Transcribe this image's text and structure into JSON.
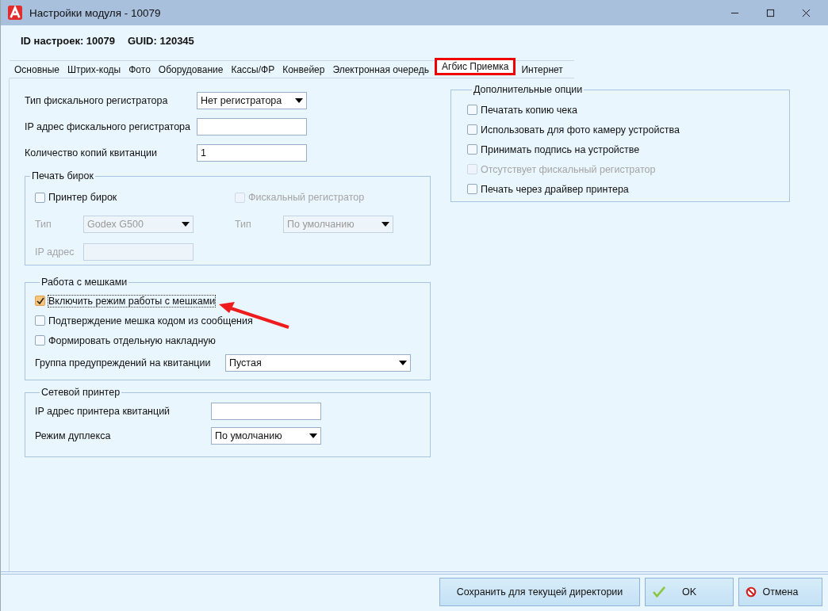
{
  "window": {
    "title": "Настройки модуля  - 10079"
  },
  "header": {
    "id_label": "ID настроек: 10079",
    "guid_label": "GUID: 120345"
  },
  "tabs": [
    {
      "label": "Основные",
      "selected": false
    },
    {
      "label": "Штрих-коды",
      "selected": false
    },
    {
      "label": "Фото",
      "selected": false
    },
    {
      "label": "Оборудование",
      "selected": false
    },
    {
      "label": "Кассы/ФР",
      "selected": false
    },
    {
      "label": "Конвейер",
      "selected": false
    },
    {
      "label": "Электронная очередь",
      "selected": false
    },
    {
      "label": "Агбис Приемка",
      "selected": true
    },
    {
      "label": "Интернет",
      "selected": false
    }
  ],
  "fields": [
    {
      "kind": "select",
      "label": "Тип фискального регистратора",
      "value": "Нет регистратора"
    },
    {
      "kind": "input",
      "label": "IP адрес фискального регистратора"
    },
    {
      "kind": "input",
      "label": "Количество копий квитанции",
      "value": "1"
    }
  ],
  "label_printing": {
    "title": "Печать бирок",
    "printer_checkbox": {
      "label": "Принтер бирок",
      "checked": false,
      "disabled": false
    },
    "fiscal_checkbox": {
      "label": "Фискальный регистратор",
      "checked": false,
      "disabled": true
    },
    "type_left": {
      "label": "Тип",
      "value": "Godex G500",
      "disabled": true
    },
    "type_right": {
      "label": "Тип",
      "value": "По умолчанию",
      "disabled": true
    },
    "ip": {
      "label": "IP адрес",
      "disabled": true
    }
  },
  "bags": {
    "title": "Работа с мешками",
    "checkboxes": [
      {
        "label": "Включить режим работы с мешками",
        "checked": true,
        "focused": true
      },
      {
        "label": "Подтверждение мешка кодом из сообщения",
        "checked": false,
        "focused": false
      },
      {
        "label": "Формировать отдельную накладную",
        "checked": false,
        "focused": false
      }
    ],
    "warning_group": {
      "label": "Группа предупреждений на квитанции",
      "value": "Пустая"
    }
  },
  "network_printer": {
    "title": "Сетевой принтер",
    "ip": {
      "label": "IP адрес принтера квитанций"
    },
    "duplex": {
      "label": "Режим дуплекса",
      "value": "По умолчанию"
    }
  },
  "extra_options": {
    "title": "Дополнительные опции",
    "checkboxes": [
      {
        "label": "Печатать копию чека",
        "checked": false,
        "disabled": false
      },
      {
        "label": "Использовать для фото камеру устройства",
        "checked": false,
        "disabled": false
      },
      {
        "label": "Принимать подпись на устройстве",
        "checked": false,
        "disabled": false
      },
      {
        "label": "Отсутствует фискальный регистратор",
        "checked": false,
        "disabled": true
      },
      {
        "label": "Печать через драйвер принтера",
        "checked": false,
        "disabled": false
      }
    ]
  },
  "buttons": [
    {
      "kind": "save",
      "label": "Сохранить для текущей директории"
    },
    {
      "kind": "ok",
      "label": "OK"
    },
    {
      "kind": "cancel",
      "label": "Отмена"
    }
  ]
}
